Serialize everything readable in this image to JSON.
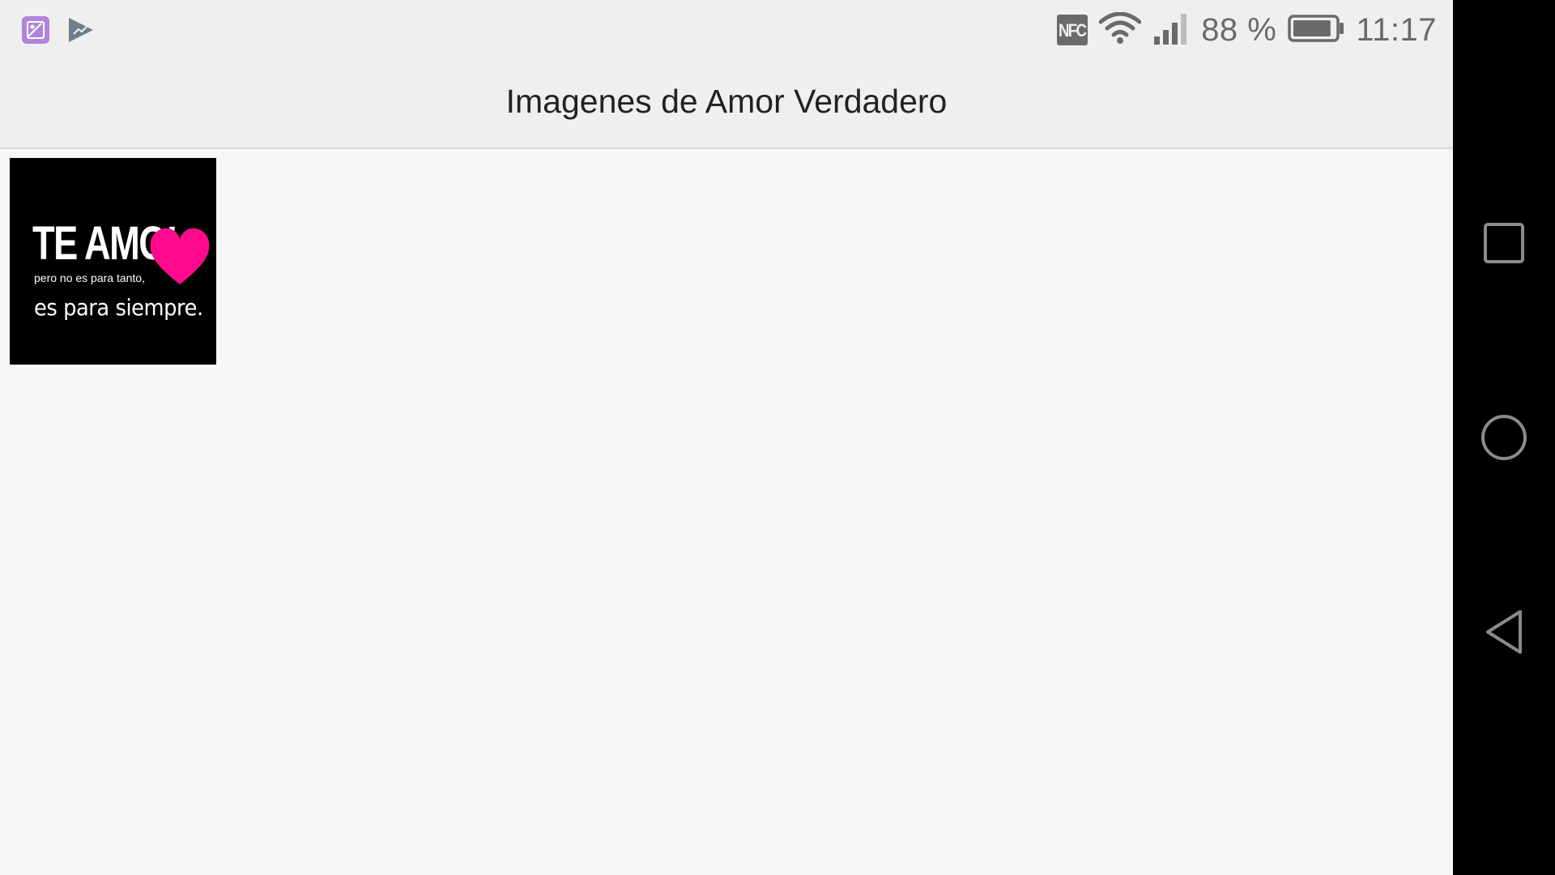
{
  "status_bar": {
    "left_icons": [
      "gallery-app-icon",
      "play-store-icon"
    ],
    "nfc_label": "NFC",
    "battery_percent": "88 %",
    "battery_level": 0.88,
    "time": "11:17"
  },
  "app_bar": {
    "title": "Imagenes de Amor Verdadero"
  },
  "gallery": {
    "items": [
      {
        "main_text": "TE AMO!",
        "small_text": "pero no es para tanto,",
        "script_text": "es para siempre.",
        "heart_color": "#ff0a8c"
      }
    ]
  },
  "nav_bar": {
    "buttons": [
      "recents-icon",
      "home-icon",
      "back-icon"
    ]
  },
  "colors": {
    "status_bar_bg": "#efefef",
    "content_bg": "#f7f7f7",
    "nav_bar_bg": "#000000",
    "status_icon": "#6a6a6a"
  }
}
